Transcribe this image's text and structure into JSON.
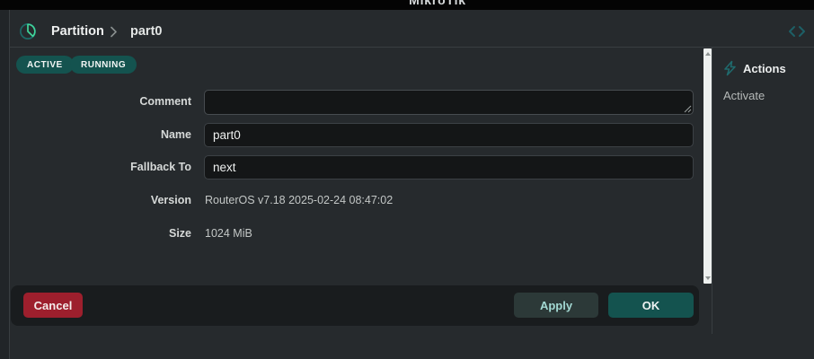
{
  "topbar": {
    "brand": "MikroTik"
  },
  "header": {
    "breadcrumb": {
      "root": "Partition",
      "current": "part0"
    },
    "icons": {
      "left": "partition-pie-icon",
      "right": "code-chevrons-icon"
    }
  },
  "status_badges": [
    {
      "label": "ACTIVE"
    },
    {
      "label": "RUNNING"
    }
  ],
  "form": {
    "fields": [
      {
        "label": "Comment",
        "type": "textarea",
        "value": ""
      },
      {
        "label": "Name",
        "type": "text",
        "value": "part0"
      },
      {
        "label": "Fallback To",
        "type": "text",
        "value": "next"
      },
      {
        "label": "Version",
        "type": "static",
        "value": "RouterOS v7.18 2025-02-24 08:47:02"
      },
      {
        "label": "Size",
        "type": "static",
        "value": "1024 MiB"
      }
    ]
  },
  "footer": {
    "cancel_label": "Cancel",
    "apply_label": "Apply",
    "ok_label": "OK"
  },
  "actions_panel": {
    "title": "Actions",
    "items": [
      {
        "label": "Activate"
      }
    ]
  },
  "colors": {
    "badge_teal": "#14534f",
    "ok_teal": "#14534f",
    "cancel_red": "#9d1f2d",
    "apply_bg": "#2c3938",
    "apply_text": "#a3d9d3",
    "icon_teal_dark": "#1d6b68",
    "icon_green": "#41d69b",
    "panel_bg": "#262a2d",
    "topbar_bg": "#040404"
  }
}
